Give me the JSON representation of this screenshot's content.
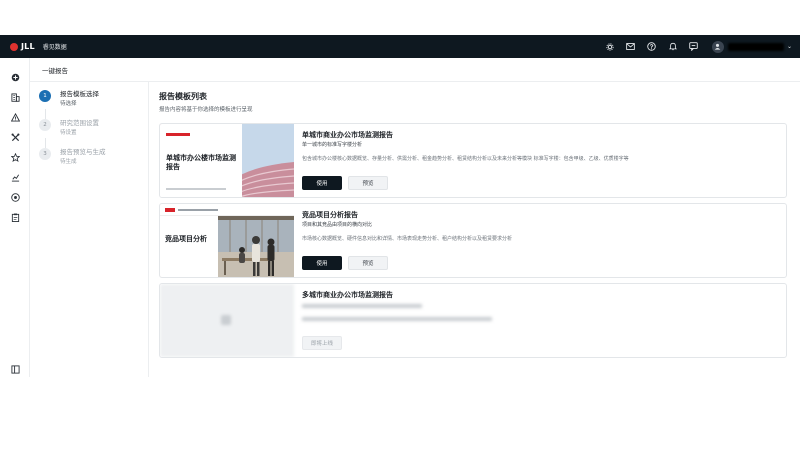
{
  "app": {
    "brand": "JLL",
    "product": "睿见数据",
    "colors": {
      "topbar": "#0e1820",
      "accent": "#1b6fb3",
      "brand_red": "#e0322f"
    }
  },
  "topbar": {
    "icons": [
      "gear-icon",
      "mail-icon",
      "help-icon",
      "bell-icon",
      "message-icon"
    ],
    "user_icon": "user-icon",
    "caret": "⌄"
  },
  "sidebar": {
    "icons": [
      "add-circle-icon",
      "building-icon",
      "alert-icon",
      "tools-icon",
      "star-icon",
      "chart-icon",
      "plus-circle-icon",
      "clipboard-icon"
    ],
    "bottom_icon": "collapse-icon"
  },
  "header": {
    "title": "一键报告"
  },
  "steps": [
    {
      "num": "1",
      "title": "报告模板选择",
      "sub": "待选择",
      "active": true
    },
    {
      "num": "2",
      "title": "研究范围设置",
      "sub": "待设置",
      "active": false
    },
    {
      "num": "3",
      "title": "报告预览与生成",
      "sub": "待生成",
      "active": false
    }
  ],
  "main": {
    "title": "报告模板列表",
    "subtitle": "报告内容将基于你选择的模板进行呈现",
    "cards": [
      {
        "title": "单城市商业办公市场监测报告",
        "sub": "单一城市的标准写字楼分析",
        "desc": "包含城市办公楼核心数据概览、存量分析、供需分析、租金趋势分析、租赁结构分析以及未来分析等模块 标准写字楼：包含甲级、乙级、优质楼字等",
        "thumb_title": "单城市办公楼市场监测报告",
        "use_label": "使用",
        "preview_label": "预览"
      },
      {
        "title": "竞品项目分析报告",
        "sub": "项目和其竞品由项目的横向对比",
        "desc": "市场核心数据概览、硬件信息对比和详情、市场表现走势分析、租户结构分析以及租赁要求分析",
        "thumb_title": "竞品项目分析",
        "use_label": "使用",
        "preview_label": "预览"
      },
      {
        "title": "多城市商业办公市场监测报告",
        "action_label": "即将上线"
      }
    ]
  }
}
